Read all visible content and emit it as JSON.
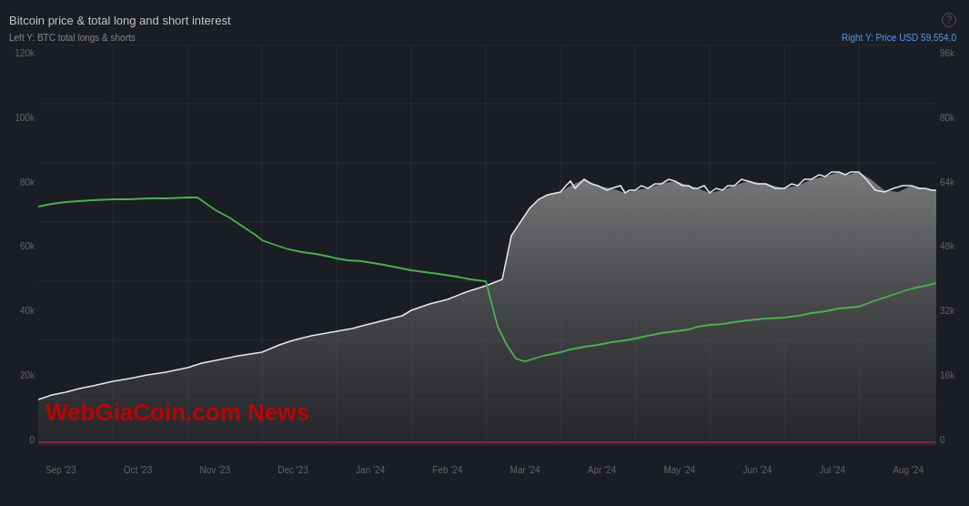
{
  "chart": {
    "title": "Bitcoin price & total long and short interest",
    "left_axis_label": "Left Y: BTC total longs & shorts",
    "right_axis_label": "Right Y: Price USD 59,554.0",
    "help_icon": "?",
    "left_y_axis": [
      "120k",
      "100k",
      "80k",
      "60k",
      "40k",
      "20k",
      "0"
    ],
    "right_y_axis": [
      "96k",
      "80k",
      "64k",
      "48k",
      "32k",
      "16k",
      "0"
    ],
    "x_axis": [
      "Sep '23",
      "Oct '23",
      "Nov '23",
      "Dec '23",
      "Jan '24",
      "Feb '24",
      "Mar '24",
      "Apr '24",
      "May '24",
      "Jun '24",
      "Jul '24",
      "Aug '24"
    ],
    "watermark": "WebGiaCoin.com News",
    "colors": {
      "background": "#1a1d24",
      "grid": "#2a2d35",
      "white_line": "#e0e0e0",
      "green_line": "#4caf50",
      "area_fill": "#808080",
      "right_label": "#4a9eff"
    }
  }
}
